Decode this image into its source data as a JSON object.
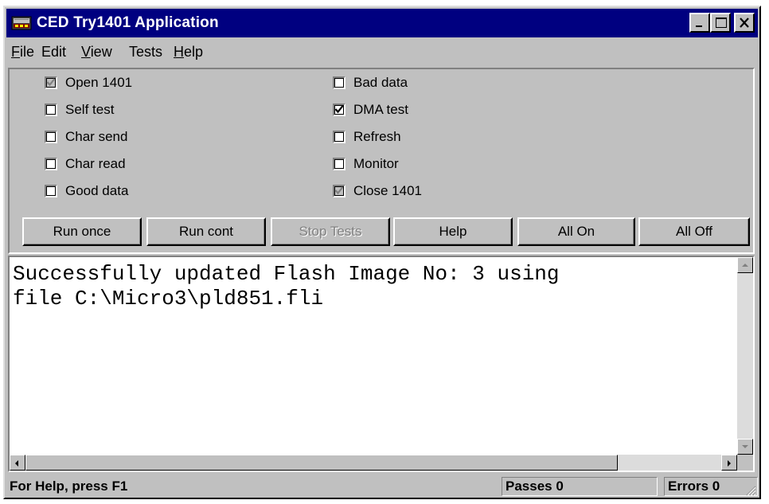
{
  "window": {
    "title": "CED Try1401 Application",
    "controls": {
      "minimize_icon": "minimize-icon",
      "maximize_icon": "maximize-icon",
      "close_icon": "close-icon"
    }
  },
  "menu": {
    "items": [
      {
        "label": "File",
        "accel": "F"
      },
      {
        "label": "Edit",
        "accel": ""
      },
      {
        "label": "View",
        "accel": "V"
      },
      {
        "label": "Tests",
        "accel": ""
      },
      {
        "label": "Help",
        "accel": "H"
      }
    ]
  },
  "checkboxes": {
    "left": [
      {
        "label": "Open 1401",
        "checked": true,
        "disabled": true
      },
      {
        "label": "Self test",
        "checked": false,
        "disabled": false
      },
      {
        "label": "Char send",
        "checked": false,
        "disabled": false
      },
      {
        "label": "Char read",
        "checked": false,
        "disabled": false
      },
      {
        "label": "Good data",
        "checked": false,
        "disabled": false
      }
    ],
    "right": [
      {
        "label": "Bad data",
        "checked": false,
        "disabled": false
      },
      {
        "label": "DMA test",
        "checked": true,
        "disabled": false
      },
      {
        "label": "Refresh",
        "checked": false,
        "disabled": false
      },
      {
        "label": "Monitor",
        "checked": false,
        "disabled": false
      },
      {
        "label": "Close 1401",
        "checked": true,
        "disabled": true
      }
    ]
  },
  "buttons": [
    {
      "label": "Run once",
      "disabled": false
    },
    {
      "label": "Run cont",
      "disabled": false
    },
    {
      "label": "Stop Tests",
      "disabled": true
    },
    {
      "label": "Help",
      "disabled": false
    },
    {
      "label": "All On",
      "disabled": false
    },
    {
      "label": "All Off",
      "disabled": false
    }
  ],
  "output": {
    "text": "Successfully updated Flash Image No: 3 using\nfile C:\\Micro3\\pld851.fli"
  },
  "status": {
    "help": "For Help, press F1",
    "passes": "Passes 0",
    "errors": "Errors 0"
  },
  "colors": {
    "title_bar": "#000080",
    "face": "#c0c0c0"
  }
}
